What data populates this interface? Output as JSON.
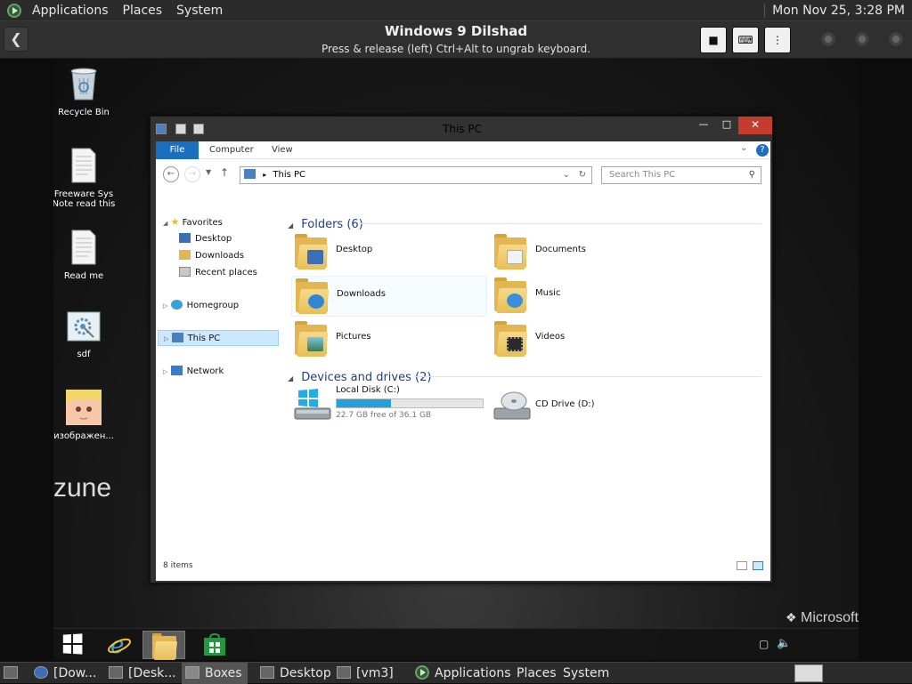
{
  "gnome_top": {
    "menus": [
      "Applications",
      "Places",
      "System"
    ],
    "clock": "Mon Nov 25,  3:28 PM"
  },
  "boxes": {
    "title": "Windows 9  Dilshad",
    "subtitle": "Press & release (left) Ctrl+Alt to ungrab keyboard."
  },
  "desktop": {
    "icons": [
      {
        "label": "Recycle Bin",
        "icon": "recycle-bin-icon"
      },
      {
        "label": "Freeware Sys Note read this",
        "icon": "text-document-icon"
      },
      {
        "label": "Read me",
        "icon": "text-document-icon"
      },
      {
        "label": "sdf",
        "icon": "settings-document-icon"
      },
      {
        "label": "изображен...",
        "icon": "image-thumbnail-icon"
      }
    ],
    "zune_logo": "zune",
    "microsoft_logo": "Microsoft"
  },
  "explorer": {
    "title": "This PC",
    "ribbon_tabs": [
      "File",
      "Computer",
      "View"
    ],
    "address": "This PC",
    "search_placeholder": "Search This PC",
    "nav": {
      "favorites": "Favorites",
      "favorites_items": [
        "Desktop",
        "Downloads",
        "Recent places"
      ],
      "homegroup": "Homegroup",
      "this_pc": "This PC",
      "network": "Network"
    },
    "folders_header": "Folders (6)",
    "folders": [
      "Desktop",
      "Documents",
      "Downloads",
      "Music",
      "Pictures",
      "Videos"
    ],
    "devices_header": "Devices and drives (2)",
    "drives": {
      "local_disk": {
        "label": "Local Disk (C:)",
        "free_text": "22.7 GB free of 36.1 GB",
        "used_fraction": 0.371
      },
      "cd_drive": {
        "label": "CD Drive (D:)"
      }
    },
    "status": "8 items"
  },
  "gnome_bottom": {
    "tasks": [
      "[Dow...",
      "[Desk...",
      "Boxes",
      "Desktop",
      "[vm3]"
    ],
    "menus": [
      "Applications",
      "Places",
      "System"
    ]
  },
  "colors": {
    "file_tab": "#1b6fc1",
    "drive_bar": "#26a0da",
    "close_button": "#c43c2e",
    "group_title": "#1e3f8a",
    "selected_nav": "#cce8ff"
  }
}
